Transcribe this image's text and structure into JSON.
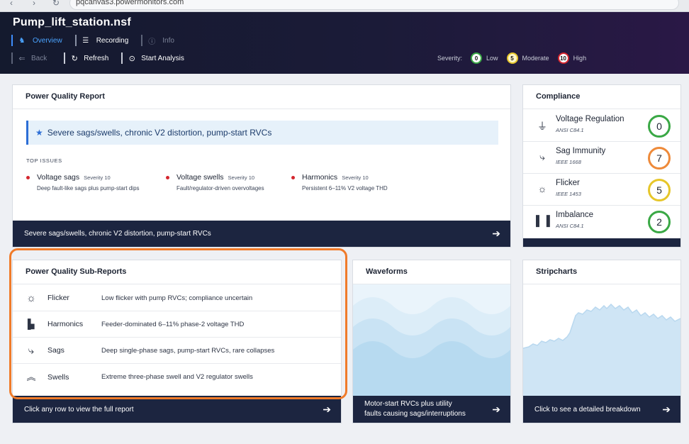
{
  "browser": {
    "url": "pqcanvas3.powermonitors.com"
  },
  "header": {
    "title": "Pump_lift_station.nsf",
    "tabs": [
      {
        "label": "Overview",
        "icon": "person-sitemap-icon",
        "state": "active"
      },
      {
        "label": "Recording",
        "icon": "list-icon",
        "state": "normal"
      },
      {
        "label": "Info",
        "icon": "info-icon",
        "state": "disabled"
      }
    ],
    "toolbar": {
      "back_label": "Back",
      "refresh_label": "Refresh",
      "start_analysis_label": "Start Analysis"
    },
    "severity": {
      "label": "Severity:",
      "levels": [
        {
          "value": "0",
          "label": "Low",
          "color": "#3aa845"
        },
        {
          "value": "5",
          "label": "Moderate",
          "color": "#e6c62a"
        },
        {
          "value": "10",
          "label": "High",
          "color": "#d4262e"
        }
      ]
    }
  },
  "report": {
    "title": "Power Quality Report",
    "summary": "Severe sags/swells, chronic V2 distortion, pump-start RVCs",
    "top_issues_label": "TOP ISSUES",
    "issues": [
      {
        "name": "Voltage sags",
        "severity": "Severity 10",
        "desc": "Deep fault-like sags plus pump-start dips"
      },
      {
        "name": "Voltage swells",
        "severity": "Severity 10",
        "desc": "Fault/regulator-driven overvoltages"
      },
      {
        "name": "Harmonics",
        "severity": "Severity 10",
        "desc": "Persistent 6–11% V2 voltage THD"
      }
    ],
    "footer": "Severe sags/swells, chronic V2 distortion, pump-start RVCs"
  },
  "compliance": {
    "title": "Compliance",
    "items": [
      {
        "name": "Voltage Regulation",
        "standard": "ANSI C84.1",
        "value": "0",
        "color": "#3aa845",
        "icon": "plug-icon"
      },
      {
        "name": "Sag Immunity",
        "standard": "IEEE 1668",
        "value": "7",
        "color": "#ee8a3a",
        "icon": "sag-icon"
      },
      {
        "name": "Flicker",
        "standard": "IEEE 1453",
        "value": "5",
        "color": "#e6c62a",
        "icon": "sun-icon"
      },
      {
        "name": "Imbalance",
        "standard": "ANSI C84.1",
        "value": "2",
        "color": "#3aa845",
        "icon": "bar-chart-icon"
      }
    ]
  },
  "subreports": {
    "title": "Power Quality Sub-Reports",
    "rows": [
      {
        "name": "Flicker",
        "desc": "Low flicker with pump RVCs; compliance uncertain",
        "icon": "sun-icon"
      },
      {
        "name": "Harmonics",
        "desc": "Feeder-dominated 6–11% phase-2 voltage THD",
        "icon": "bar-chart-icon"
      },
      {
        "name": "Sags",
        "desc": "Deep single-phase sags, pump-start RVCs, rare collapses",
        "icon": "sag-icon"
      },
      {
        "name": "Swells",
        "desc": "Extreme three-phase swell and V2 regulator swells",
        "icon": "double-chevron-up-icon"
      }
    ],
    "footer": "Click any row to view the full report"
  },
  "waveforms": {
    "title": "Waveforms",
    "footer_line1": "Motor-start RVCs plus utility",
    "footer_line2": "faults causing sags/interruptions"
  },
  "stripcharts": {
    "title": "Stripcharts",
    "footer": "Click to see a detailed breakdown"
  }
}
